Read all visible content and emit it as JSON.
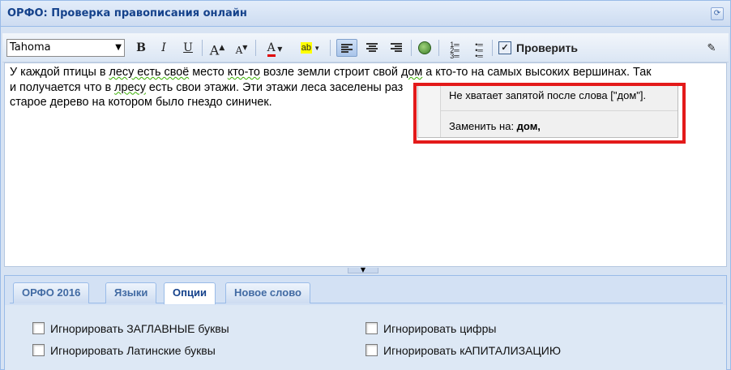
{
  "window": {
    "title": "ОРФО: Проверка правописания онлайн",
    "refresh_tool": "⟳"
  },
  "toolbar": {
    "font": "Tahoma",
    "bold": "B",
    "italic": "I",
    "underline": "U",
    "grow_font": "A",
    "shrink_font": "A",
    "font_color": "A",
    "highlight": "ab",
    "check_label": "Проверить"
  },
  "editor": {
    "line1_a": "У каждой птицы в ",
    "line1_sq1": "лесу есть своё",
    "line1_b": " место ",
    "line1_sq2": "кто-то",
    "line1_c": " возле земли строит свой ",
    "line1_sq3": "дом",
    "line1_d": " а кто-то на самых высоких вершинах. Так",
    "line2_a": "и получается что в ",
    "line2_sq1": "лресу",
    "line2_b": " есть свои этажи. Эти этажи леса заселены раз",
    "line3": "старое дерево на котором было гнездо синичек."
  },
  "popup": {
    "message": "Не хватает запятой после слова [\"дом\"].",
    "replace_prefix": "Заменить на: ",
    "replace_value": "дом,"
  },
  "tabs": [
    "ОРФО 2016",
    "Языки",
    "Опции",
    "Новое слово"
  ],
  "options": {
    "ignore_caps": "Игнорировать ЗАГЛАВНЫЕ буквы",
    "ignore_latin": "Игнорировать Латинские буквы",
    "ignore_digits": "Игнорировать цифры",
    "ignore_capitalization": "Игнорировать кАПИТАЛИЗАЦИЮ"
  },
  "colors": {
    "accent": "#15428b",
    "highlight_frame": "#e31a1a",
    "font_color_bar": "#e00000",
    "highlight_bar": "#ffff00"
  }
}
